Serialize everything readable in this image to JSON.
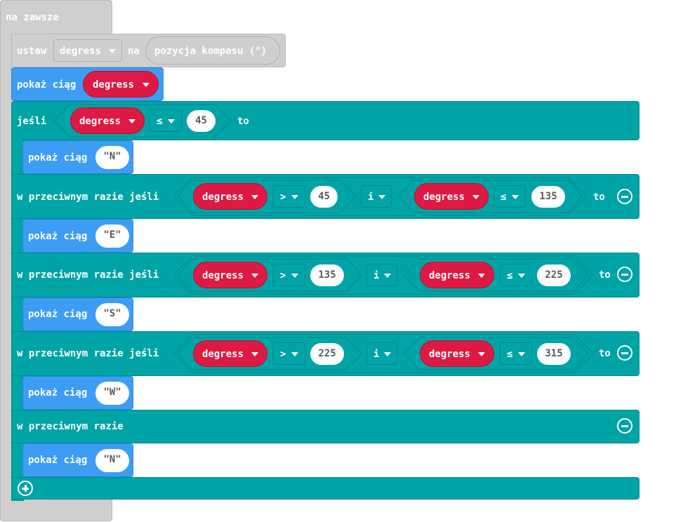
{
  "forever": {
    "label": "na zawsze"
  },
  "set_block": {
    "label": "ustaw",
    "variable": "degress",
    "to_label": "na",
    "sensor": "pozycja kompasu (°)"
  },
  "show_degrees": {
    "label": "pokaż ciąg",
    "variable": "degress"
  },
  "if_block": {
    "if_label": "jeśli",
    "then_label": "to",
    "else_if_label": "w przeciwnym razie jeśli",
    "else_label": "w przeciwnym razie",
    "and_label": "i",
    "var": "degress",
    "op_gt": ">",
    "op_le": "≤",
    "branches": [
      {
        "lo": "",
        "hi": "45",
        "show_label": "pokaż ciąg",
        "text": "\"N\""
      },
      {
        "lo": "45",
        "hi": "135",
        "show_label": "pokaż ciąg",
        "text": "\"E\""
      },
      {
        "lo": "135",
        "hi": "225",
        "show_label": "pokaż ciąg",
        "text": "\"S\""
      },
      {
        "lo": "225",
        "hi": "315",
        "show_label": "pokaż ciąg",
        "text": "\"W\""
      }
    ],
    "else_branch": {
      "show_label": "pokaż ciąg",
      "text": "\"N\""
    }
  },
  "colors": {
    "teal": "#00a4a6",
    "blue": "#3d9df5",
    "red": "#dc1a44",
    "grey": "#cfcfcf"
  }
}
